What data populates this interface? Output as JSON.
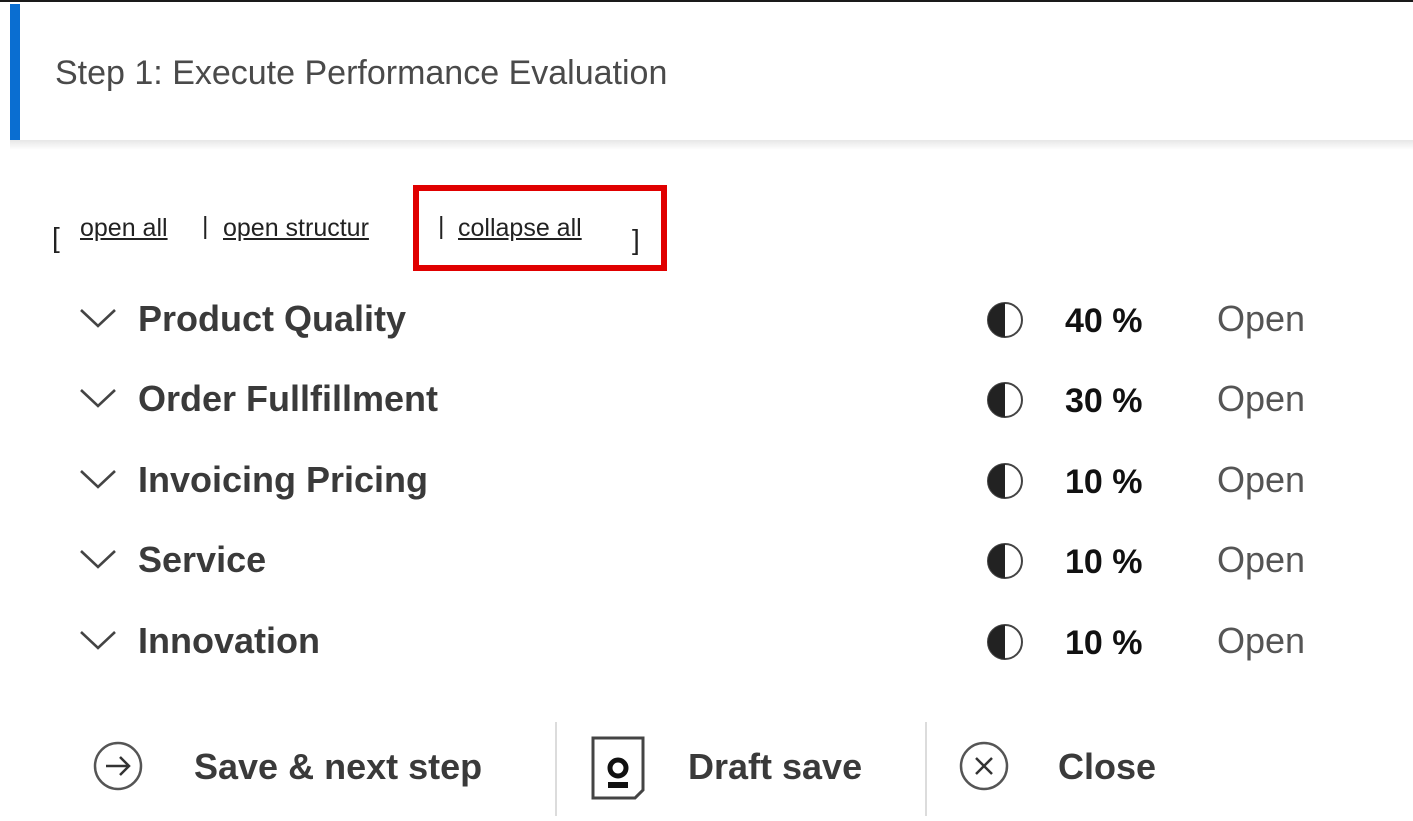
{
  "header": {
    "title": "Step 1: Execute Performance Evaluation",
    "accent_color": "#0a6ed1"
  },
  "links": {
    "open_bracket": "[",
    "open_all": "open all",
    "sep1": "|",
    "open_structure": "open structur",
    "sep2": "|",
    "collapse_all": "collapse all",
    "close_bracket": "]",
    "highlight_color": "#e00000"
  },
  "criteria": [
    {
      "label": "Product Quality",
      "weight": "40 %",
      "status": "Open",
      "icon": "half-circle-icon",
      "expand_icon": "chevron-down-icon"
    },
    {
      "label": "Order Fullfillment",
      "weight": "30 %",
      "status": "Open",
      "icon": "half-circle-icon",
      "expand_icon": "chevron-down-icon"
    },
    {
      "label": "Invoicing Pricing",
      "weight": "10 %",
      "status": "Open",
      "icon": "half-circle-icon",
      "expand_icon": "chevron-down-icon"
    },
    {
      "label": "Service",
      "weight": "10 %",
      "status": "Open",
      "icon": "half-circle-icon",
      "expand_icon": "chevron-down-icon"
    },
    {
      "label": "Innovation",
      "weight": "10 %",
      "status": "Open",
      "icon": "half-circle-icon",
      "expand_icon": "chevron-down-icon"
    }
  ],
  "footer": {
    "save_next": {
      "label": "Save & next step",
      "icon": "arrow-right-circle-icon"
    },
    "draft_save": {
      "label": "Draft save",
      "icon": "disk-icon"
    },
    "close": {
      "label": "Close",
      "icon": "close-circle-icon"
    }
  }
}
